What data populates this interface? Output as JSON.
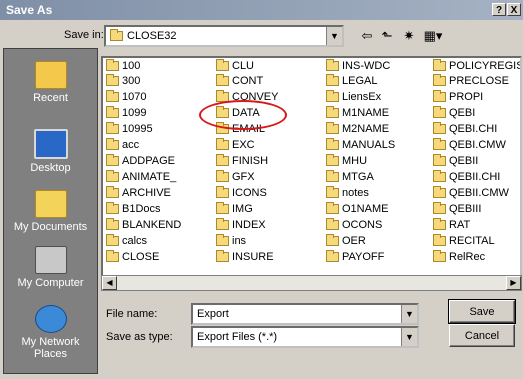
{
  "window": {
    "title": "Save As",
    "help_label": "?",
    "close_label": "X"
  },
  "toolbar": {
    "savein_label": "Save in:",
    "savein_value": "CLOSE32",
    "back_icon": "back-arrow-icon",
    "up_icon": "up-folder-icon",
    "newfolder_icon": "new-folder-icon",
    "views_icon": "views-menu-icon"
  },
  "places": [
    {
      "label": "Recent",
      "icon": "recent-icon"
    },
    {
      "label": "Desktop",
      "icon": "desktop-icon"
    },
    {
      "label": "My Documents",
      "icon": "my-documents-icon"
    },
    {
      "label": "My Computer",
      "icon": "my-computer-icon"
    },
    {
      "label": "My Network Places",
      "icon": "network-icon"
    }
  ],
  "files": {
    "col1": [
      "100",
      "300",
      "1070",
      "1099",
      "10995",
      "acc",
      "ADDPAGE",
      "ANIMATE_",
      "ARCHIVE",
      "B1Docs",
      "BLANKEND",
      "calcs",
      "CLOSE"
    ],
    "col2": [
      "CLU",
      "CONT",
      "CONVEY",
      "DATA",
      "EMAIL",
      "EXC",
      "FINISH",
      "GFX",
      "ICONS",
      "IMG",
      "INDEX",
      "ins",
      "INSURE"
    ],
    "col3": [
      "INS-WDC",
      "LEGAL",
      "LiensEx",
      "M1NAME",
      "M2NAME",
      "MANUALS",
      "MHU",
      "MTGA",
      "notes",
      "O1NAME",
      "OCONS",
      "OER",
      "PAYOFF"
    ],
    "col4": [
      "POLICYREGISTE",
      "PRECLOSE",
      "PROPI",
      "QEBI",
      "QEBI.CHI",
      "QEBI.CMW",
      "QEBII",
      "QEBII.CHI",
      "QEBII.CMW",
      "QEBIII",
      "RAT",
      "RECITAL",
      "RelRec"
    ]
  },
  "form": {
    "filename_label": "File name:",
    "filename_value": "Export",
    "savetype_label": "Save as type:",
    "savetype_value": "Export Files (*.*)",
    "save_button": "Save",
    "cancel_button": "Cancel"
  },
  "annotation": {
    "color": "#d81818"
  }
}
